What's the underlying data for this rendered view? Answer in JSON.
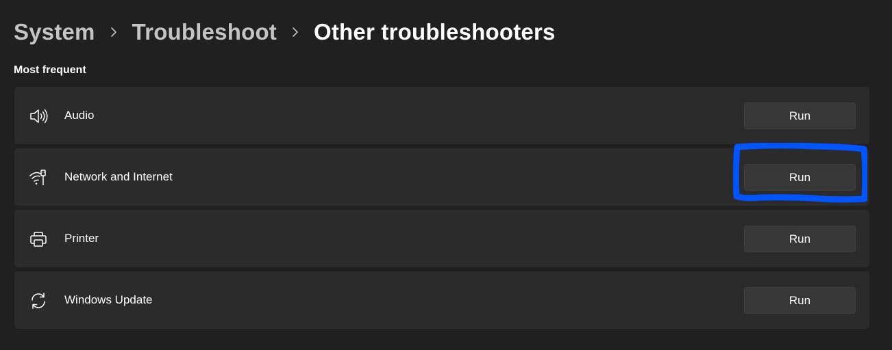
{
  "breadcrumb": {
    "items": [
      "System",
      "Troubleshoot",
      "Other troubleshooters"
    ]
  },
  "section": {
    "heading": "Most frequent"
  },
  "troubleshooters": [
    {
      "label": "Audio",
      "icon": "speaker-icon",
      "button_label": "Run"
    },
    {
      "label": "Network and Internet",
      "icon": "wifi-ethernet-icon",
      "button_label": "Run"
    },
    {
      "label": "Printer",
      "icon": "printer-icon",
      "button_label": "Run"
    },
    {
      "label": "Windows Update",
      "icon": "sync-icon",
      "button_label": "Run"
    }
  ],
  "annotation": {
    "highlight_color": "#0055ff",
    "highlighted_item": "Network and Internet"
  },
  "colors": {
    "background": "#202020",
    "card": "#2b2b2b",
    "button": "#373737",
    "breadcrumb_inactive": "#c4c4c4"
  }
}
